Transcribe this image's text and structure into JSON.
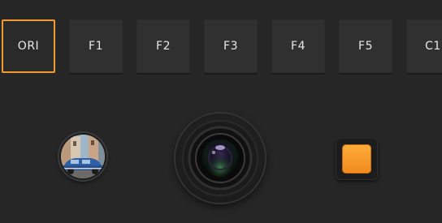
{
  "filters": [
    {
      "label": "ORI",
      "selected": true
    },
    {
      "label": "F1",
      "selected": false
    },
    {
      "label": "F2",
      "selected": false
    },
    {
      "label": "F3",
      "selected": false
    },
    {
      "label": "F4",
      "selected": false
    },
    {
      "label": "F5",
      "selected": false
    },
    {
      "label": "C1",
      "selected": false
    }
  ],
  "colors": {
    "background": "#262626",
    "filter_button": "#303030",
    "selected_border": "#f29a2e",
    "record_accent": "#f7951f"
  },
  "gallery": {
    "icon": "photo-thumbnail"
  },
  "shutter": {
    "icon": "camera-lens-icon"
  },
  "record": {
    "icon": "stop-square-icon"
  }
}
